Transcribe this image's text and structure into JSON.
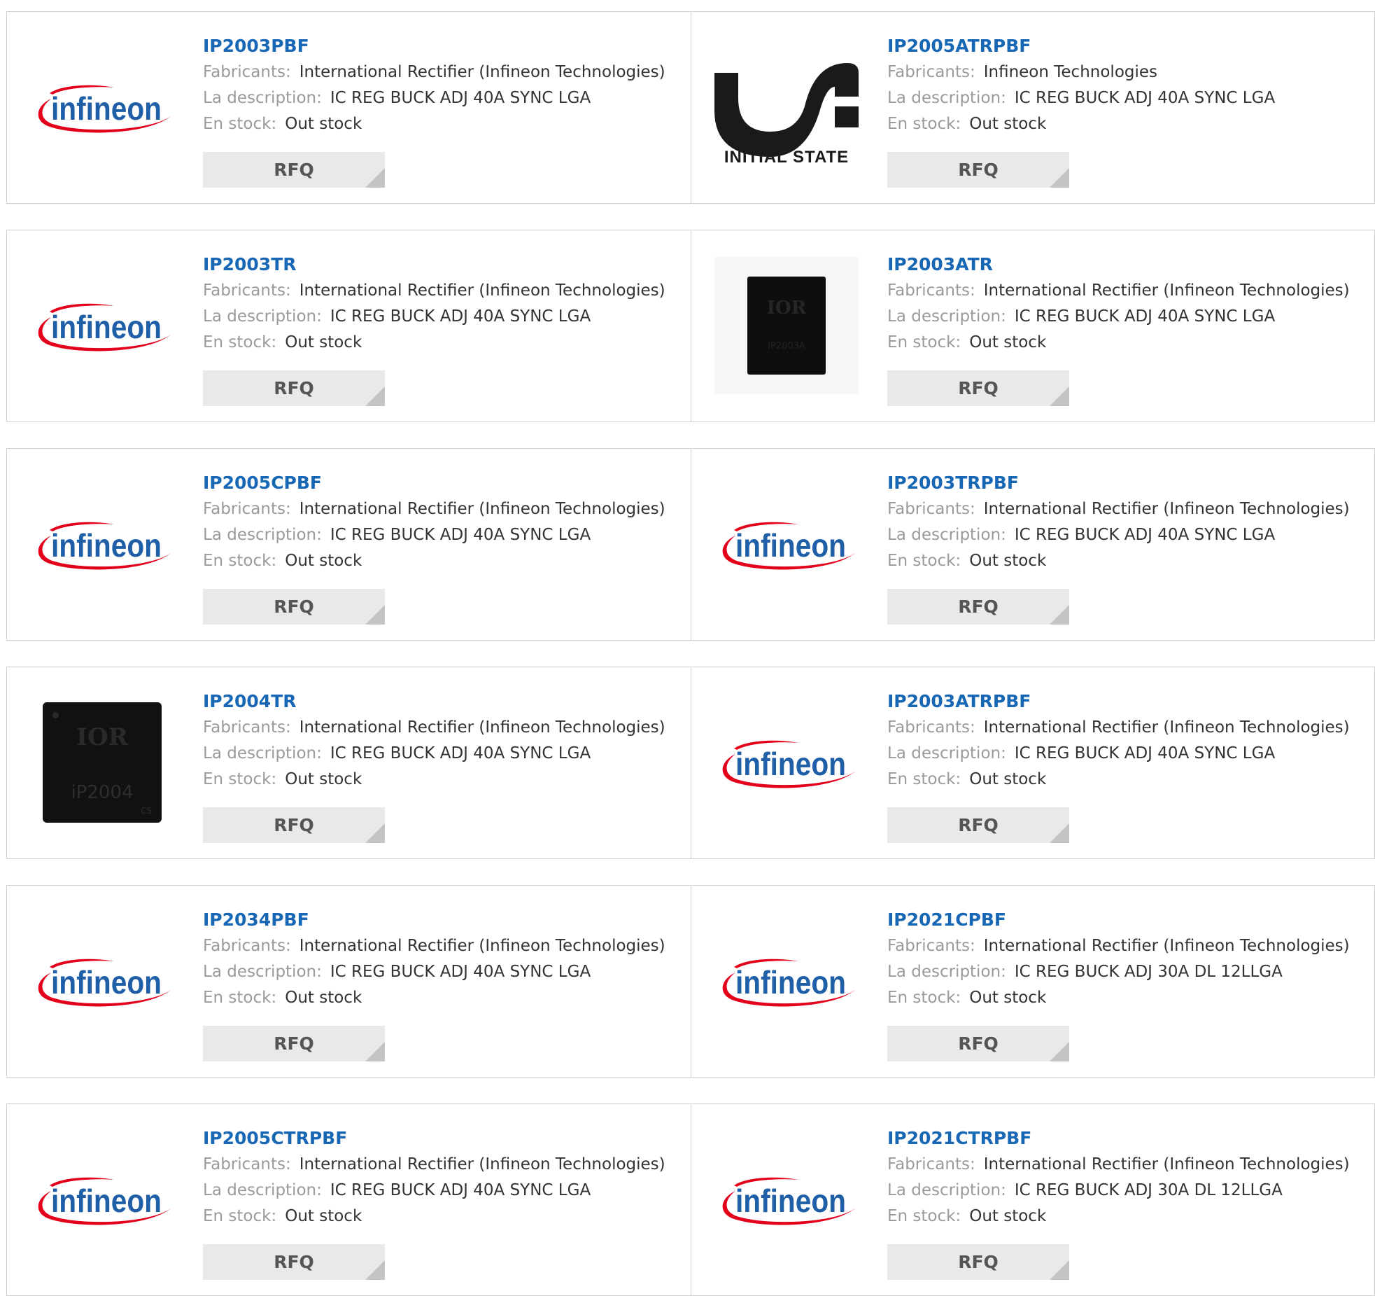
{
  "labels": {
    "manufacturer": "Fabricants:",
    "description": "La description:",
    "stock": "En stock:",
    "rfq": "RFQ"
  },
  "logos": {
    "infineon": "infineon",
    "initial_state": "INITIAL STATE",
    "ior": "IOR",
    "chip_2003a": "IP2003A",
    "chip_2004": "iP2004",
    "chip_2004_code": "CS"
  },
  "colors": {
    "link": "#1767b5",
    "infineon_blue": "#1f5fa8",
    "infineon_red": "#e3001b",
    "rfq_bg": "#e9e9e9"
  },
  "rows": [
    [
      {
        "part": "IP2003PBF",
        "manufacturer": "International Rectifier (Infineon Technologies)",
        "description": "IC REG BUCK ADJ 40A SYNC LGA",
        "stock": "Out stock",
        "logo": "infineon"
      },
      {
        "part": "IP2005ATRPBF",
        "manufacturer": "Infineon Technologies",
        "description": "IC REG BUCK ADJ 40A SYNC LGA",
        "stock": "Out stock",
        "logo": "initial-state"
      }
    ],
    [
      {
        "part": "IP2003TR",
        "manufacturer": "International Rectifier (Infineon Technologies)",
        "description": "IC REG BUCK ADJ 40A SYNC LGA",
        "stock": "Out stock",
        "logo": "infineon"
      },
      {
        "part": "IP2003ATR",
        "manufacturer": "International Rectifier (Infineon Technologies)",
        "description": "IC REG BUCK ADJ 40A SYNC LGA",
        "stock": "Out stock",
        "logo": "chip-ip2003a"
      }
    ],
    [
      {
        "part": "IP2005CPBF",
        "manufacturer": "International Rectifier (Infineon Technologies)",
        "description": "IC REG BUCK ADJ 40A SYNC LGA",
        "stock": "Out stock",
        "logo": "infineon"
      },
      {
        "part": "IP2003TRPBF",
        "manufacturer": "International Rectifier (Infineon Technologies)",
        "description": "IC REG BUCK ADJ 40A SYNC LGA",
        "stock": "Out stock",
        "logo": "infineon"
      }
    ],
    [
      {
        "part": "IP2004TR",
        "manufacturer": "International Rectifier (Infineon Technologies)",
        "description": "IC REG BUCK ADJ 40A SYNC LGA",
        "stock": "Out stock",
        "logo": "chip-ip2004"
      },
      {
        "part": "IP2003ATRPBF",
        "manufacturer": "International Rectifier (Infineon Technologies)",
        "description": "IC REG BUCK ADJ 40A SYNC LGA",
        "stock": "Out stock",
        "logo": "infineon"
      }
    ],
    [
      {
        "part": "IP2034PBF",
        "manufacturer": "International Rectifier (Infineon Technologies)",
        "description": "IC REG BUCK ADJ 40A SYNC LGA",
        "stock": "Out stock",
        "logo": "infineon"
      },
      {
        "part": "IP2021CPBF",
        "manufacturer": "International Rectifier (Infineon Technologies)",
        "description": "IC REG BUCK ADJ 30A DL 12LLGA",
        "stock": "Out stock",
        "logo": "infineon"
      }
    ],
    [
      {
        "part": "IP2005CTRPBF",
        "manufacturer": "International Rectifier (Infineon Technologies)",
        "description": "IC REG BUCK ADJ 40A SYNC LGA",
        "stock": "Out stock",
        "logo": "infineon"
      },
      {
        "part": "IP2021CTRPBF",
        "manufacturer": "International Rectifier (Infineon Technologies)",
        "description": "IC REG BUCK ADJ 30A DL 12LLGA",
        "stock": "Out stock",
        "logo": "infineon"
      }
    ]
  ]
}
